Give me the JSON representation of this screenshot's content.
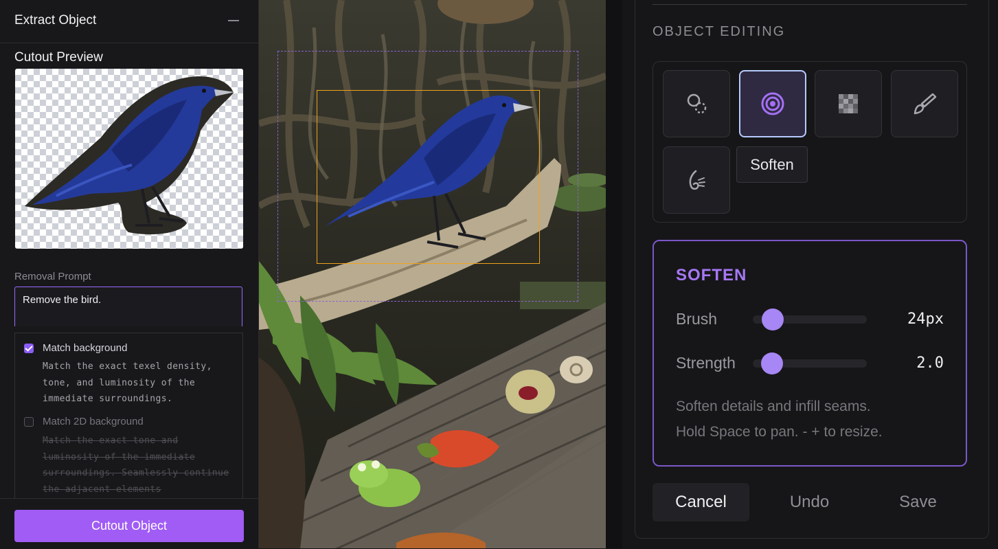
{
  "left_panel": {
    "title": "Extract Object",
    "cutout_preview_label": "Cutout Preview",
    "removal_prompt_label": "Removal Prompt",
    "removal_prompt_value": "Remove the bird.",
    "options": [
      {
        "label": "Match background",
        "checked": true,
        "description": "Match the exact texel density, tone, and luminosity of the immediate surroundings."
      },
      {
        "label": "Match 2D background",
        "checked": false,
        "description": "Match the exact tone and luminosity of the immediate surroundings. Seamlessly continue the adjacent elements"
      }
    ],
    "primary_button": "Cutout Object"
  },
  "right_panel": {
    "section_title": "OBJECT EDITING",
    "tools": [
      {
        "icon": "spot-heal-icon",
        "active": false
      },
      {
        "icon": "soften-target-icon",
        "active": true
      },
      {
        "icon": "pixelate-icon",
        "active": false
      },
      {
        "icon": "paint-brush-icon",
        "active": false
      },
      {
        "icon": "smudge-icon",
        "active": false
      }
    ],
    "tooltip": "Soften",
    "settings": {
      "title": "SOFTEN",
      "brush_label": "Brush",
      "brush_value": "24px",
      "brush_level": 0.13,
      "strength_label": "Strength",
      "strength_value": "2.0",
      "strength_level": 0.12,
      "hint_line_1": "Soften details and infill seams.",
      "hint_line_2": "Hold Space to pan. - + to resize."
    },
    "buttons": {
      "cancel": "Cancel",
      "undo": "Undo",
      "save": "Save"
    }
  },
  "colors": {
    "accent": "#a05cf5",
    "selection": "#f0a21c",
    "active_tool_border": "#b6cbff"
  }
}
